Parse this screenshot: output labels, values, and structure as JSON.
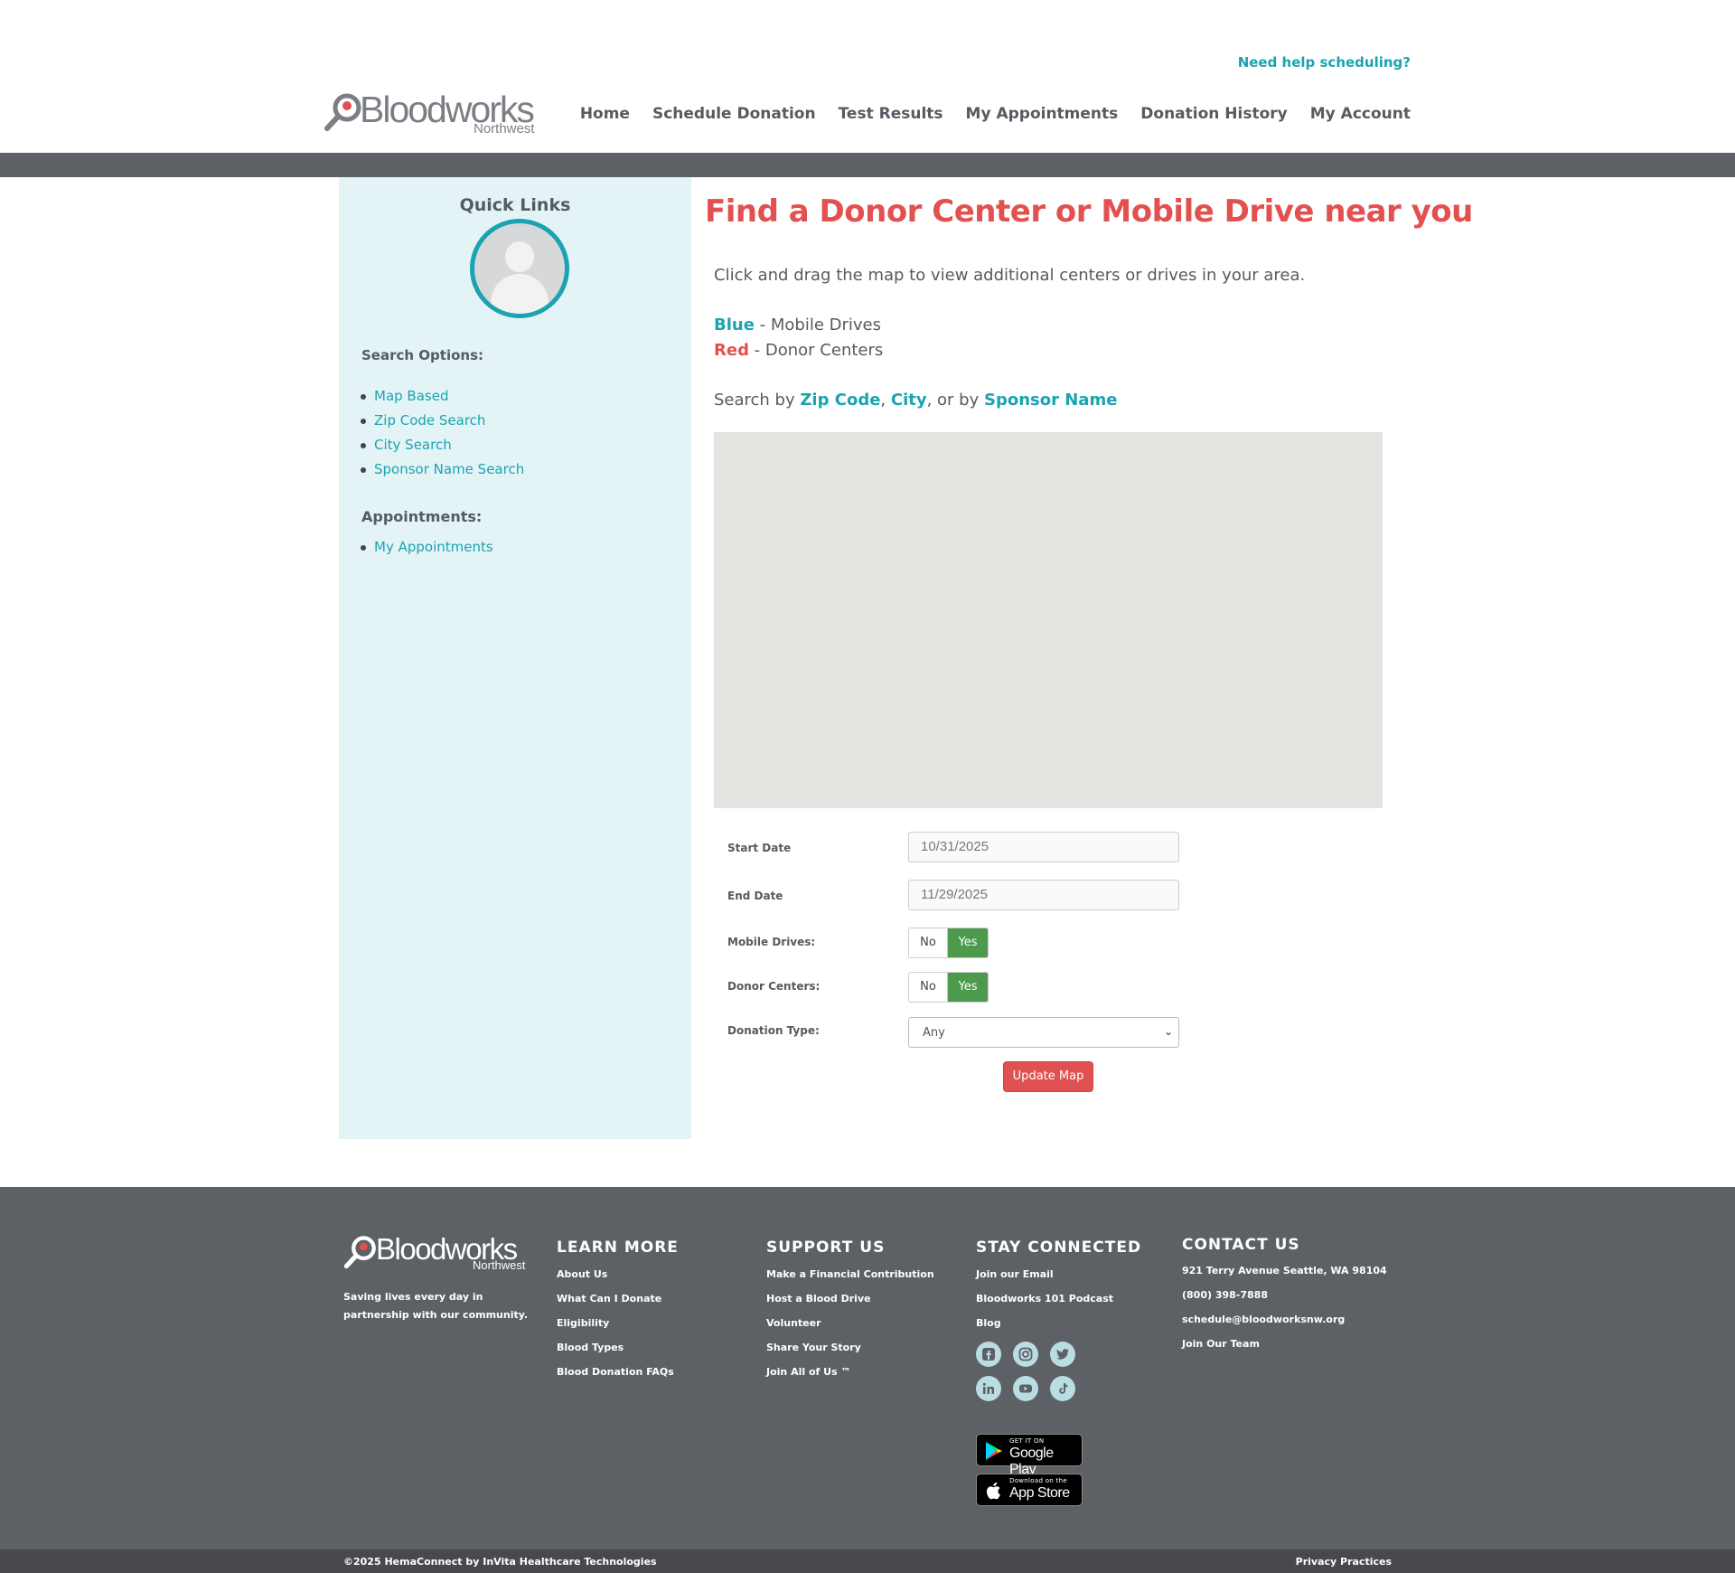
{
  "header": {
    "help_link": "Need help scheduling?",
    "logo_word": "Bloodworks",
    "logo_sub": "Northwest",
    "nav": [
      "Home",
      "Schedule Donation",
      "Test Results",
      "My Appointments",
      "Donation History",
      "My Account"
    ]
  },
  "sidebar": {
    "title": "Quick Links",
    "search_heading": "Search Options:",
    "search_links": [
      "Map Based",
      "Zip Code Search",
      "City Search",
      "Sponsor Name Search"
    ],
    "appointments_heading": "Appointments:",
    "appointment_links": [
      "My Appointments"
    ]
  },
  "main": {
    "title": "Find a Donor Center or Mobile Drive near you",
    "instruction": "Click and drag the map to view additional centers or drives in your area.",
    "legend_blue_word": "Blue",
    "legend_blue_text": " - Mobile Drives",
    "legend_red_word": "Red",
    "legend_red_text": " - Donor Centers",
    "search_prefix": "Search by ",
    "search_zip": "Zip Code",
    "search_comma": ", ",
    "search_city": "City",
    "search_or": ", or by ",
    "search_sponsor": "Sponsor Name"
  },
  "form": {
    "start_date_label": "Start Date",
    "start_date_value": "10/31/2025",
    "end_date_label": "End Date",
    "end_date_value": "11/29/2025",
    "mobile_drives_label": "Mobile Drives:",
    "donor_centers_label": "Donor Centers:",
    "toggle_no": "No",
    "toggle_yes": "Yes",
    "donation_type_label": "Donation Type:",
    "donation_type_value": "Any",
    "update_button": "Update Map"
  },
  "footer": {
    "logo_word": "Bloodworks",
    "logo_sub": "Northwest",
    "tagline": "Saving lives every day in partnership with our community.",
    "learn_more": {
      "heading": "LEARN MORE",
      "links": [
        "About Us",
        "What Can I Donate",
        "Eligibility",
        "Blood Types",
        "Blood Donation FAQs"
      ]
    },
    "support_us": {
      "heading": "SUPPORT US",
      "links": [
        "Make a Financial Contribution",
        "Host a Blood Drive",
        "Volunteer",
        "Share Your Story",
        "Join All of Us ™"
      ]
    },
    "stay_connected": {
      "heading": "STAY CONNECTED",
      "links": [
        "Join our Email",
        "Bloodworks 101 Podcast",
        "Blog"
      ],
      "social_icons": [
        "facebook-icon",
        "instagram-icon",
        "twitter-icon",
        "linkedin-icon",
        "youtube-icon",
        "tiktok-icon"
      ]
    },
    "contact_us": {
      "heading": "CONTACT US",
      "links": [
        "921 Terry Avenue Seattle, WA 98104",
        "(800) 398-7888",
        "schedule@bloodworksnw.org",
        "Join Our Team"
      ]
    },
    "google_play_small": "GET IT ON",
    "google_play_big": "Google Play",
    "app_store_small": "Download on the",
    "app_store_big": "App Store",
    "copyright": "©2025 HemaConnect by InVita Healthcare Technologies",
    "privacy": "Privacy Practices"
  },
  "colors": {
    "accent_teal": "#1aa3b1",
    "accent_red": "#e2514f",
    "toggle_green": "#4d9a4d",
    "footer_grey": "#5d6064"
  }
}
